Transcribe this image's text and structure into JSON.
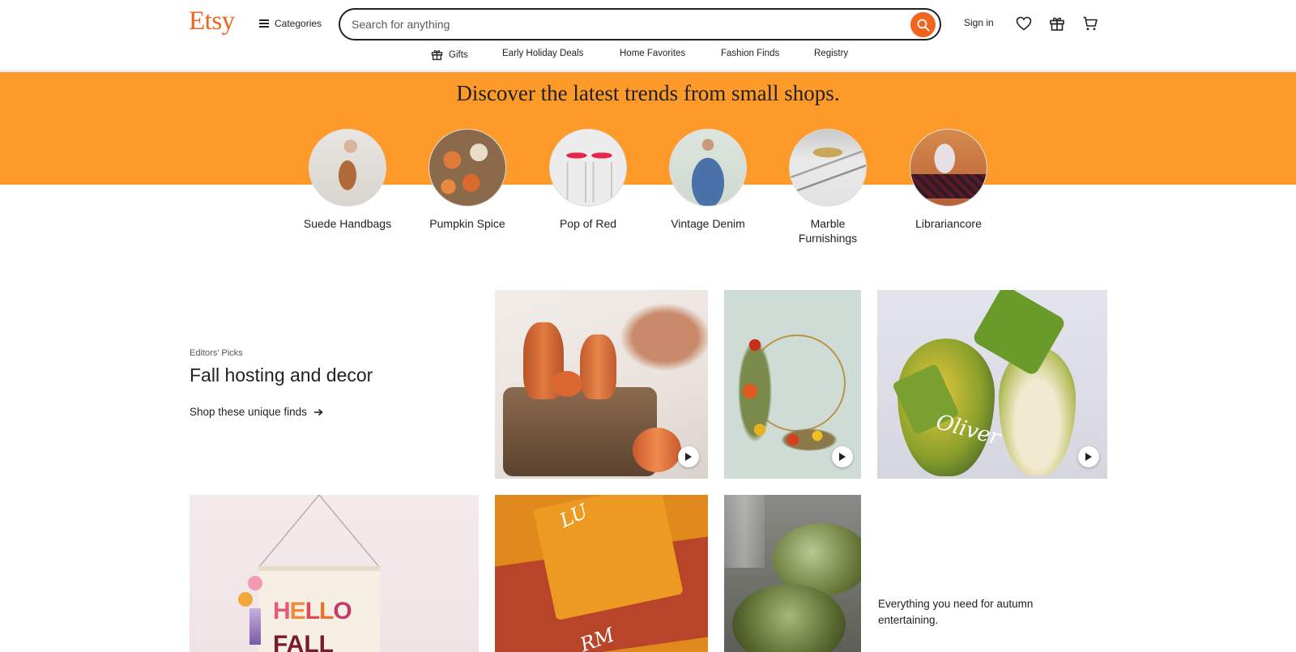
{
  "header": {
    "logo": "Etsy",
    "categories_label": "Categories",
    "search_placeholder": "Search for anything",
    "signin_label": "Sign in"
  },
  "nav": {
    "items": [
      "Gifts",
      "Early Holiday Deals",
      "Home Favorites",
      "Fashion Finds",
      "Registry"
    ]
  },
  "banner": {
    "title": "Discover the latest trends from small shops.",
    "trends": [
      {
        "label": "Suede Handbags"
      },
      {
        "label": "Pumpkin Spice"
      },
      {
        "label": "Pop of Red"
      },
      {
        "label": "Vintage Denim"
      },
      {
        "label": "Marble Furnishings"
      },
      {
        "label": "Librariancore"
      }
    ]
  },
  "editors_picks": {
    "kicker": "Editors' Picks",
    "title": "Fall hosting and decor",
    "link": "Shop these unique finds",
    "caption": "Everything you need for autumn entertaining."
  },
  "colors": {
    "brand": "#F1641E",
    "banner": "#FD9A2A"
  }
}
